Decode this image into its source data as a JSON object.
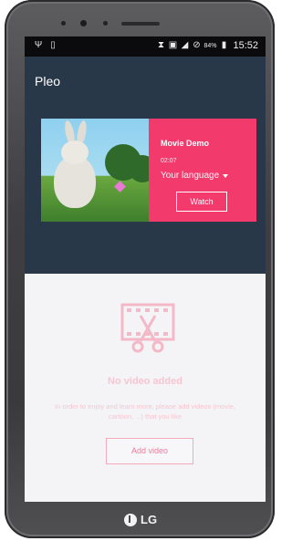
{
  "device": {
    "brand": "LG"
  },
  "status_bar": {
    "left_icons": [
      "usb-icon",
      "notification-icon"
    ],
    "right_icons": [
      "vibrate-icon",
      "nfc-icon",
      "signal-icon",
      "no-sim-icon"
    ],
    "battery_percent": "84%",
    "time": "15:52"
  },
  "app_bar": {
    "title": "Pleo"
  },
  "movie_card": {
    "name": "Movie Demo",
    "duration": "02:07",
    "language_label": "Your language",
    "watch_label": "Watch",
    "accent_color": "#f23a6c"
  },
  "empty_state": {
    "title": "No video added",
    "description": "In order to enjoy and learn more, please add videos (movie, cartoon, ...) that you like",
    "add_label": "Add video",
    "icon": "film-scissors-icon",
    "color": "#f7c5d1"
  },
  "colors": {
    "header_bg": "#293848",
    "screen_bg": "#f4f4f6"
  }
}
